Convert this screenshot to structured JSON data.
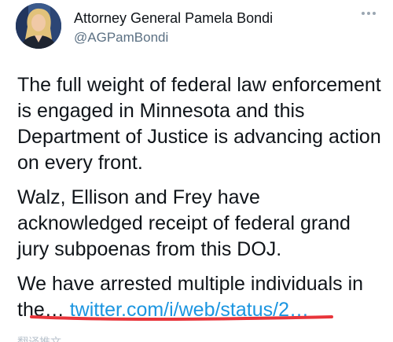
{
  "tweet": {
    "author": {
      "display_name": "Attorney General Pamela Bondi",
      "handle": "@AGPamBondi",
      "avatar_icon": "profile-photo"
    },
    "more_icon": "more-horizontal-icon",
    "paragraphs": [
      "The full weight of federal law enforcement is engaged in Minnesota and this Department of Justice is advancing action on every front.",
      "Walz, Ellison and Frey have acknowledged receipt of federal grand jury subpoenas from this DOJ."
    ],
    "last_paragraph": {
      "text": "We have arrested multiple individuals in the… ",
      "link": "twitter.com/i/web/status/2…"
    },
    "cut_off_text": "翻译推文"
  },
  "colors": {
    "link": "#1b95e0",
    "handle": "#5b7083",
    "annotation_underline": "#e8343a"
  }
}
